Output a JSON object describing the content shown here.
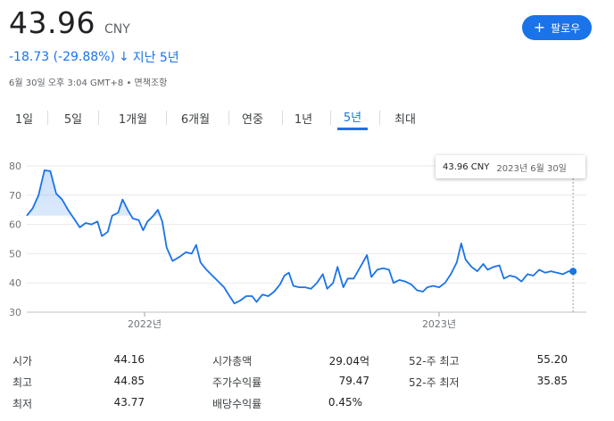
{
  "header": {
    "price": "43.96",
    "currency": "CNY",
    "follow_label": "팔로우",
    "change": "-18.73 (-29.88%)",
    "change_arrow": "↓",
    "period": "지난 5년",
    "meta": "6월 30일 오후 3:04 GMT+8 • 면책조항"
  },
  "tabs": [
    {
      "label": "1일"
    },
    {
      "label": "5일"
    },
    {
      "label": "1개월"
    },
    {
      "label": "6개월"
    },
    {
      "label": "연중"
    },
    {
      "label": "1년"
    },
    {
      "label": "5년"
    },
    {
      "label": "최대"
    }
  ],
  "active_tab": "5년",
  "tooltip": {
    "value": "43.96 CNY",
    "date": "2023년 6월 30일"
  },
  "colors": {
    "accent": "#1a73e8",
    "line": "#1a73e8",
    "text": "#202124",
    "muted": "#5f6368"
  },
  "chart_data": {
    "type": "area",
    "y_ticks": [
      "80",
      "70",
      "60",
      "50",
      "40",
      "30"
    ],
    "ylim": [
      30,
      80
    ],
    "x_ticks": [
      {
        "label": "2022년",
        "x": 2022.0
      },
      {
        "label": "2023년",
        "x": 2023.0
      }
    ],
    "xlim": [
      2021.6,
      2023.5
    ],
    "grid": true,
    "series": [
      {
        "values": [
          [
            2021.6,
            63.0
          ],
          [
            2021.62,
            65.5
          ],
          [
            2021.64,
            70.0
          ],
          [
            2021.66,
            78.5
          ],
          [
            2021.68,
            78.2
          ],
          [
            2021.7,
            70.5
          ],
          [
            2021.72,
            68.5
          ],
          [
            2021.74,
            65.0
          ],
          [
            2021.76,
            62.0
          ],
          [
            2021.78,
            59.0
          ],
          [
            2021.8,
            60.5
          ],
          [
            2021.82,
            60.0
          ],
          [
            2021.84,
            61.0
          ],
          [
            2021.855,
            56.0
          ],
          [
            2021.875,
            57.5
          ],
          [
            2021.89,
            63.0
          ],
          [
            2021.91,
            64.0
          ],
          [
            2021.925,
            68.5
          ],
          [
            2021.945,
            64.5
          ],
          [
            2021.96,
            62.0
          ],
          [
            2021.98,
            61.5
          ],
          [
            2021.995,
            58.0
          ],
          [
            2022.01,
            61.0
          ],
          [
            2022.03,
            63.0
          ],
          [
            2022.045,
            65.0
          ],
          [
            2022.06,
            61.0
          ],
          [
            2022.075,
            52.0
          ],
          [
            2022.095,
            47.5
          ],
          [
            2022.12,
            49.0
          ],
          [
            2022.14,
            50.5
          ],
          [
            2022.16,
            50.0
          ],
          [
            2022.175,
            53.0
          ],
          [
            2022.19,
            47.0
          ],
          [
            2022.21,
            44.5
          ],
          [
            2022.24,
            41.5
          ],
          [
            2022.27,
            38.5
          ],
          [
            2022.285,
            36.0
          ],
          [
            2022.305,
            33.0
          ],
          [
            2022.325,
            34.0
          ],
          [
            2022.345,
            35.5
          ],
          [
            2022.365,
            35.5
          ],
          [
            2022.38,
            33.5
          ],
          [
            2022.4,
            36.0
          ],
          [
            2022.42,
            35.5
          ],
          [
            2022.44,
            37.0
          ],
          [
            2022.46,
            39.5
          ],
          [
            2022.475,
            42.5
          ],
          [
            2022.49,
            43.5
          ],
          [
            2022.505,
            39.0
          ],
          [
            2022.525,
            38.5
          ],
          [
            2022.545,
            38.5
          ],
          [
            2022.565,
            38.0
          ],
          [
            2022.585,
            40.0
          ],
          [
            2022.605,
            43.0
          ],
          [
            2022.62,
            38.0
          ],
          [
            2022.64,
            40.0
          ],
          [
            2022.655,
            45.5
          ],
          [
            2022.675,
            38.5
          ],
          [
            2022.69,
            41.5
          ],
          [
            2022.71,
            41.5
          ],
          [
            2022.73,
            45.0
          ],
          [
            2022.755,
            49.5
          ],
          [
            2022.77,
            42.0
          ],
          [
            2022.79,
            44.5
          ],
          [
            2022.81,
            45.0
          ],
          [
            2022.83,
            44.5
          ],
          [
            2022.845,
            40.0
          ],
          [
            2022.865,
            41.0
          ],
          [
            2022.885,
            40.5
          ],
          [
            2022.905,
            39.5
          ],
          [
            2022.925,
            37.5
          ],
          [
            2022.945,
            37.0
          ],
          [
            2022.96,
            38.5
          ],
          [
            2022.98,
            39.0
          ],
          [
            2023.0,
            38.5
          ],
          [
            2023.02,
            40.0
          ],
          [
            2023.04,
            43.0
          ],
          [
            2023.06,
            47.0
          ],
          [
            2023.075,
            53.5
          ],
          [
            2023.09,
            48.0
          ],
          [
            2023.11,
            45.5
          ],
          [
            2023.13,
            44.0
          ],
          [
            2023.15,
            46.5
          ],
          [
            2023.165,
            44.5
          ],
          [
            2023.185,
            45.5
          ],
          [
            2023.205,
            46.0
          ],
          [
            2023.22,
            41.5
          ],
          [
            2023.24,
            42.5
          ],
          [
            2023.26,
            42.0
          ],
          [
            2023.28,
            40.5
          ],
          [
            2023.3,
            43.0
          ],
          [
            2023.32,
            42.5
          ],
          [
            2023.34,
            44.5
          ],
          [
            2023.36,
            43.5
          ],
          [
            2023.38,
            44.0
          ],
          [
            2023.4,
            43.5
          ],
          [
            2023.42,
            43.0
          ],
          [
            2023.44,
            44.0
          ],
          [
            2023.455,
            43.96
          ]
        ]
      }
    ]
  },
  "stats": [
    {
      "label": "시가",
      "value": "44.16"
    },
    {
      "label": "최고",
      "value": "44.85"
    },
    {
      "label": "최저",
      "value": "43.77"
    },
    {
      "label": "시가총액",
      "value": "29.04억"
    },
    {
      "label": "주가수익률",
      "value": "79.47"
    },
    {
      "label": "배당수익률",
      "value": "0.45%"
    },
    {
      "label": "52-주 최고",
      "value": "55.20"
    },
    {
      "label": "52-주 최저",
      "value": "35.85"
    }
  ]
}
